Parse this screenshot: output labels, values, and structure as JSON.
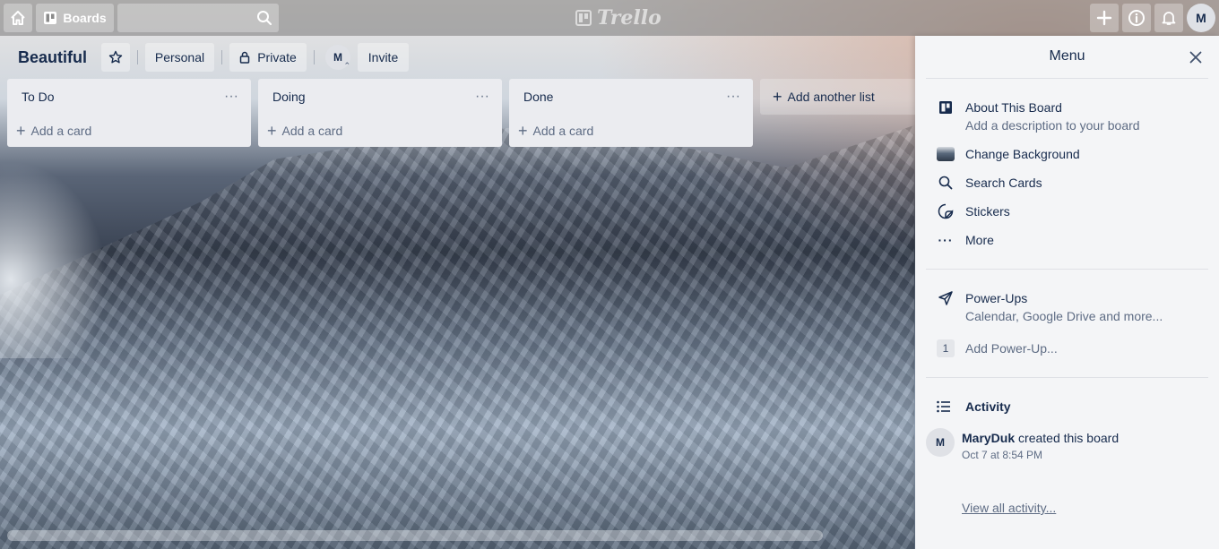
{
  "header": {
    "boards_label": "Boards",
    "search_placeholder": "",
    "logo_text": "Trello",
    "avatar_initial": "M"
  },
  "board": {
    "title": "Beautiful",
    "team_label": "Personal",
    "visibility_label": "Private",
    "member_initial": "M",
    "invite_label": "Invite"
  },
  "lists": [
    {
      "title": "To Do",
      "add_card": "Add a card"
    },
    {
      "title": "Doing",
      "add_card": "Add a card"
    },
    {
      "title": "Done",
      "add_card": "Add a card"
    }
  ],
  "add_list_label": "Add another list",
  "menu": {
    "title": "Menu",
    "items": [
      {
        "label": "About This Board",
        "sub": "Add a description to your board",
        "icon": "board-icon"
      },
      {
        "label": "Change Background",
        "icon": "background-thumbnail-icon"
      },
      {
        "label": "Search Cards",
        "icon": "search-icon"
      },
      {
        "label": "Stickers",
        "icon": "sticker-icon"
      },
      {
        "label": "More",
        "icon": "more-icon"
      }
    ],
    "powerups": {
      "label": "Power-Ups",
      "sub": "Calendar, Google Drive and more...",
      "add_count": "1",
      "add_label": "Add Power-Up..."
    },
    "activity": {
      "title": "Activity",
      "user_initial": "M",
      "user": "MaryDuk",
      "action": " created this board",
      "time": "Oct 7 at 8:54 PM",
      "view_all": "View all activity..."
    }
  }
}
